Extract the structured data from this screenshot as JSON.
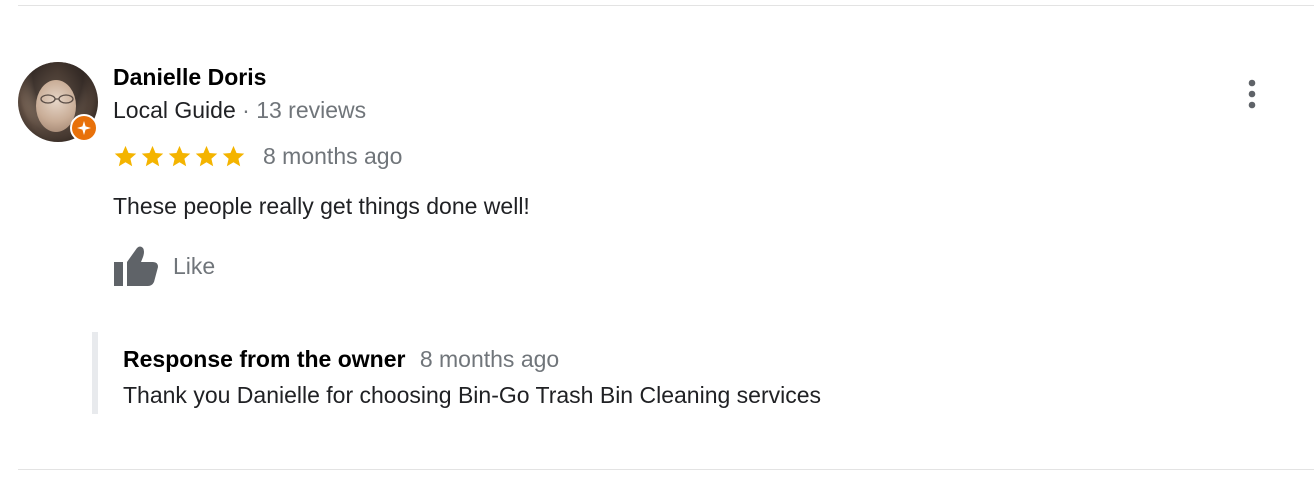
{
  "review": {
    "author": {
      "name": "Danielle Doris",
      "badge": "Local Guide",
      "separator": "·",
      "review_count": "13 reviews",
      "avatar_icon": "user-avatar-photo",
      "badge_icon": "local-guide-star-icon",
      "badge_color": "#e8710a"
    },
    "rating": {
      "stars": 5,
      "max": 5,
      "star_color": "#f4b400"
    },
    "time": "8 months ago",
    "text": "These people really get things done well!",
    "like_label": "Like",
    "menu_icon": "more-vert-icon"
  },
  "owner_response": {
    "title": "Response from the owner",
    "time": "8 months ago",
    "text": "Thank you Danielle for choosing Bin-Go Trash Bin Cleaning services"
  }
}
